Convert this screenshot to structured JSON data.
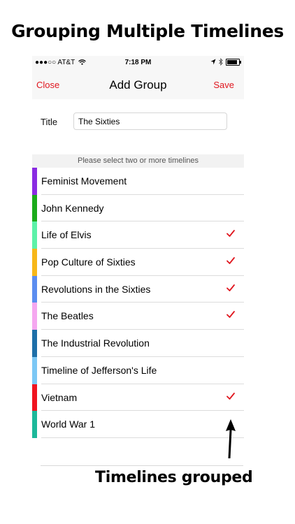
{
  "headline": "Grouping Multiple Timelines",
  "status_bar": {
    "carrier": "●●●○○ AT&T",
    "time": "7:18 PM",
    "wifi_icon": "wifi-icon",
    "location_icon": "location-arrow-icon",
    "bluetooth_icon": "bluetooth-icon",
    "battery_icon": "battery-icon"
  },
  "nav": {
    "close_label": "Close",
    "title": "Add Group",
    "save_label": "Save",
    "accent_color": "#e0161e"
  },
  "form": {
    "title_label": "Title",
    "title_value": "The Sixties"
  },
  "section_header": "Please select two or more timelines",
  "timelines": [
    {
      "label": "Feminist  Movement",
      "color": "#8a2be2",
      "selected": false
    },
    {
      "label": "John Kennedy",
      "color": "#1aaa1a",
      "selected": false
    },
    {
      "label": "Life of Elvis",
      "color": "#5cf2a8",
      "selected": true
    },
    {
      "label": "Pop Culture of Sixties",
      "color": "#f7b718",
      "selected": true
    },
    {
      "label": "Revolutions in the Sixties",
      "color": "#5b8df0",
      "selected": true
    },
    {
      "label": "The Beatles",
      "color": "#f5a7f0",
      "selected": true
    },
    {
      "label": "The Industrial Revolution",
      "color": "#1d6fa8",
      "selected": false
    },
    {
      "label": "Timeline of Jefferson's Life",
      "color": "#7cc8f5",
      "selected": false
    },
    {
      "label": "Vietnam",
      "color": "#f0131f",
      "selected": true
    },
    {
      "label": "World War 1",
      "color": "#1cb89a",
      "selected": false
    }
  ],
  "annotation": "Timelines grouped"
}
